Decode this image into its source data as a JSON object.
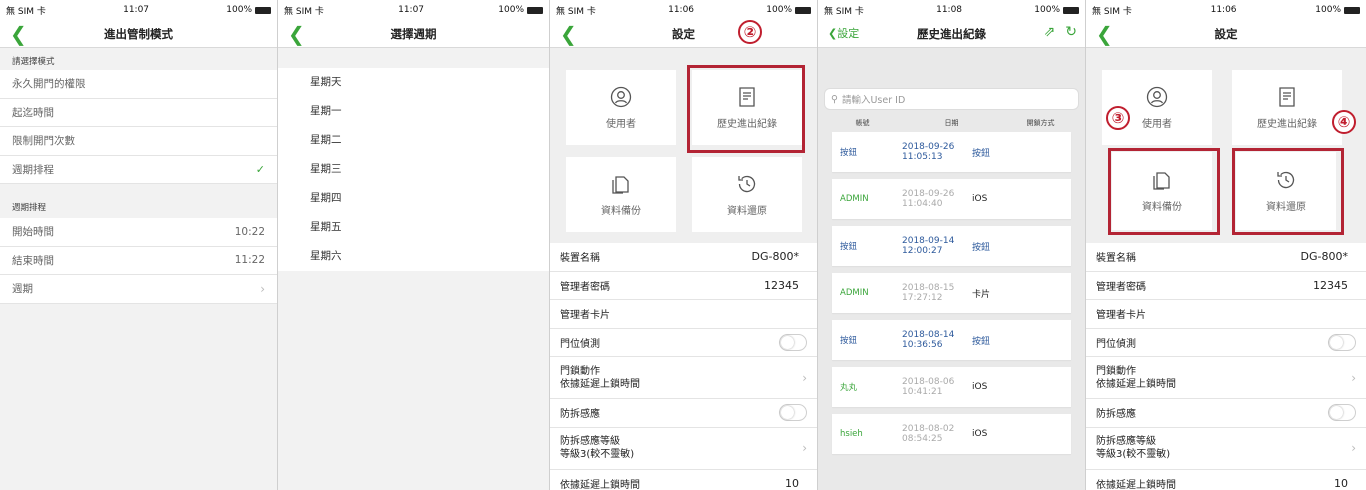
{
  "status": {
    "carrier": "無 SIM 卡",
    "battery": "100%"
  },
  "s1": {
    "time": "11:07",
    "title": "進出管制模式",
    "section1": "請選擇模式",
    "modes": [
      "永久開門的權限",
      "起迄時間",
      "限制開門次數",
      "週期排程"
    ],
    "section2": "週期排程",
    "rows": [
      {
        "label": "開始時間",
        "value": "10:22"
      },
      {
        "label": "結束時間",
        "value": "11:22"
      },
      {
        "label": "週期",
        "value": ""
      }
    ]
  },
  "s2": {
    "time": "11:07",
    "title": "選擇週期",
    "days": [
      "星期天",
      "星期一",
      "星期二",
      "星期三",
      "星期四",
      "星期五",
      "星期六"
    ]
  },
  "s3": {
    "time": "11:06",
    "title": "設定",
    "tiles": [
      "使用者",
      "歷史進出紀錄",
      "資料備份",
      "資料還原"
    ],
    "badge": "②",
    "settings": {
      "device_name": "裝置名稱",
      "device_value": "DG-800*",
      "admin_pw": "管理者密碼",
      "admin_pw_value": "12345",
      "admin_card": "管理者卡片",
      "door_sensor": "門位偵測",
      "lock_action_1": "門鎖動作",
      "lock_action_2": "依據延遲上鎖時間",
      "tamper": "防拆感應",
      "tamper_level_1": "防拆感應等級",
      "tamper_level_2": "等級3(較不靈敏)",
      "delay_lock": "依據延遲上鎖時間",
      "delay_value": "10"
    }
  },
  "s4": {
    "time": "11:08",
    "back": "設定",
    "title": "歷史進出紀錄",
    "search_placeholder": "請輸入User ID",
    "headers": [
      "帳號",
      "日期",
      "開鎖方式"
    ],
    "records": [
      {
        "account": "按鈕",
        "date": "2018-09-26",
        "time": "11:05:13",
        "method": "按鈕",
        "style": "blue"
      },
      {
        "account": "ADMIN",
        "date": "2018-09-26",
        "time": "11:04:40",
        "method": "iOS",
        "style": "green"
      },
      {
        "account": "按鈕",
        "date": "2018-09-14",
        "time": "12:00:27",
        "method": "按鈕",
        "style": "blue"
      },
      {
        "account": "ADMIN",
        "date": "2018-08-15",
        "time": "17:27:12",
        "method": "卡片",
        "style": "green"
      },
      {
        "account": "按鈕",
        "date": "2018-08-14",
        "time": "10:36:56",
        "method": "按鈕",
        "style": "blue"
      },
      {
        "account": "丸丸",
        "date": "2018-08-06",
        "time": "10:41:21",
        "method": "iOS",
        "style": "green"
      },
      {
        "account": "hsieh",
        "date": "2018-08-02",
        "time": "08:54:25",
        "method": "iOS",
        "style": "green"
      }
    ]
  },
  "s5": {
    "time": "11:06",
    "title": "設定",
    "badge_left": "③",
    "badge_right": "④"
  },
  "colors": {
    "accent_green": "#3aa53a",
    "highlight_red": "#b32434",
    "link_blue": "#2e5a9c"
  }
}
